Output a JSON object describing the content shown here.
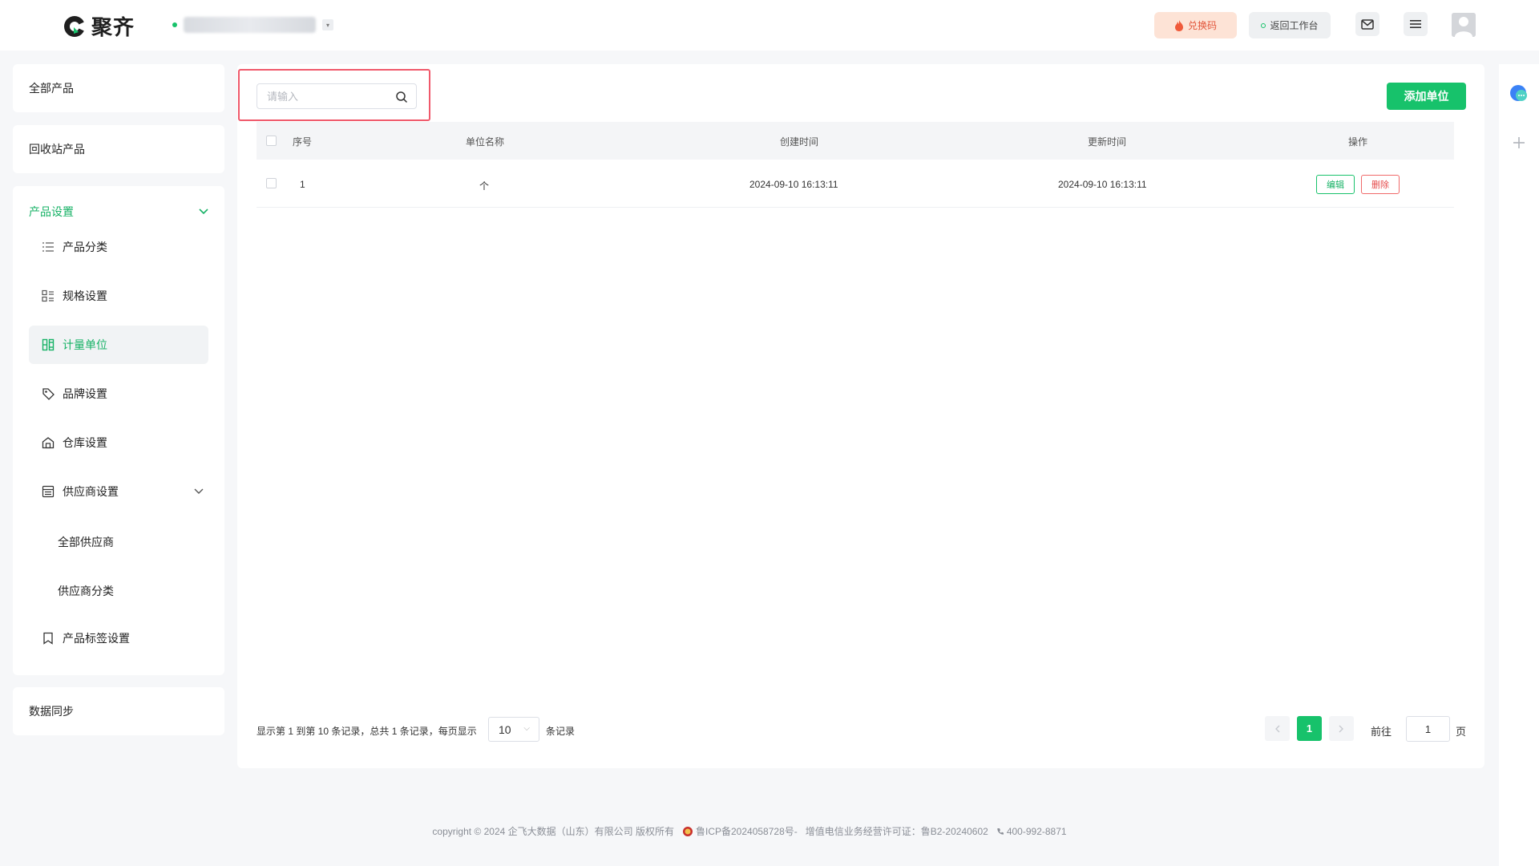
{
  "header": {
    "brand": "聚齐",
    "redeem_label": "兑换码",
    "back_label": "返回工作台",
    "icons": [
      "mail-icon",
      "menu-icon",
      "avatar"
    ]
  },
  "sidebar": {
    "all_products": "全部产品",
    "recycle_bin": "回收站产品",
    "group_title": "产品设置",
    "items": [
      {
        "label": "产品分类",
        "icon": "list-icon"
      },
      {
        "label": "规格设置",
        "icon": "spec-icon"
      },
      {
        "label": "计量单位",
        "icon": "unit-icon",
        "active": true
      },
      {
        "label": "品牌设置",
        "icon": "tag-icon"
      },
      {
        "label": "仓库设置",
        "icon": "warehouse-icon"
      },
      {
        "label": "供应商设置",
        "icon": "supplier-icon"
      },
      {
        "label": "产品标签设置",
        "icon": "bookmark-icon"
      }
    ],
    "supplier_sub": [
      "全部供应商",
      "供应商分类"
    ],
    "data_sync": "数据同步"
  },
  "toolbar": {
    "search_placeholder": "请输入",
    "add_label": "添加单位"
  },
  "table": {
    "columns": [
      "序号",
      "单位名称",
      "创建时间",
      "更新时间",
      "操作"
    ],
    "rows": [
      {
        "index": "1",
        "name": "个",
        "created": "2024-09-10 16:13:11",
        "updated": "2024-09-10 16:13:11",
        "edit": "编辑",
        "delete": "删除"
      }
    ]
  },
  "pagination": {
    "summary": "显示第 1 到第 10 条记录，总共 1 条记录，每页显示",
    "page_size": "10",
    "records_suffix": "条记录",
    "current_page": "1",
    "goto_prefix": "前往",
    "goto_value": "1",
    "goto_suffix": "页"
  },
  "footer": {
    "copyright": "copyright © 2024 企飞大数据（山东）有限公司 版权所有",
    "icp": "鲁ICP备2024058728号-",
    "license": "增值电信业务经营许可证：鲁B2-20240602",
    "phone": "400-992-8871"
  },
  "colors": {
    "accent": "#17c26b",
    "danger": "#e54b4b",
    "highlight": "#f0596b"
  }
}
